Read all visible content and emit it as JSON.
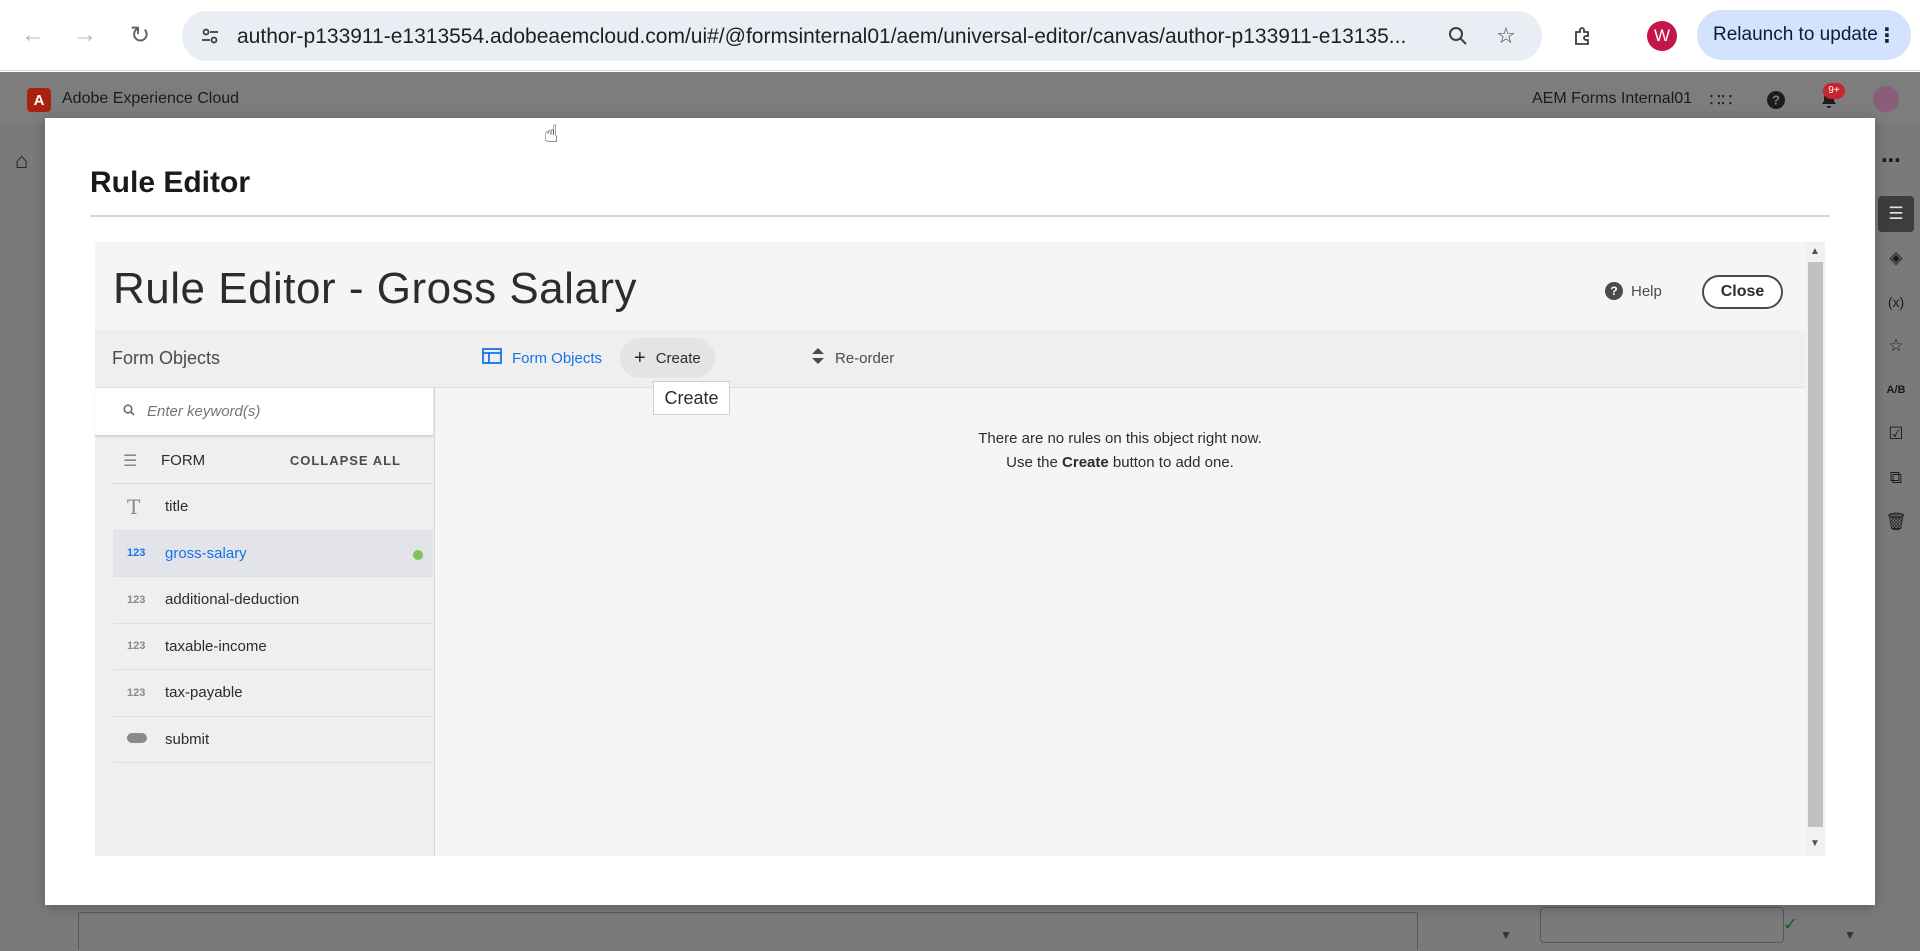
{
  "browser": {
    "url": "author-p133911-e1313554.adobeaemcloud.com/ui#/@formsinternal01/aem/universal-editor/canvas/author-p133911-e13135...",
    "profile_initial": "W",
    "relaunch_label": "Relaunch to update"
  },
  "shell": {
    "title": "Adobe Experience Cloud",
    "org_name": "AEM Forms Internal01",
    "notification_count": "9+"
  },
  "dialog": {
    "title": "Rule Editor"
  },
  "editor": {
    "title": "Rule Editor - Gross Salary",
    "help_label": "Help",
    "close_label": "Close",
    "form_objects_heading": "Form Objects",
    "toolbar": {
      "form_objects_label": "Form Objects",
      "create_label": "Create",
      "reorder_label": "Re-order",
      "create_tooltip": "Create"
    },
    "search": {
      "placeholder": "Enter keyword(s)"
    },
    "tree": {
      "root_label": "FORM",
      "collapse_all_label": "COLLAPSE ALL",
      "items": [
        {
          "label": "title",
          "icon": "text-field-icon",
          "type_glyph": "T"
        },
        {
          "label": "gross-salary",
          "icon": "number-field-icon",
          "type_glyph": "123",
          "selected": true,
          "has_rule": true
        },
        {
          "label": "additional-deduction",
          "icon": "number-field-icon",
          "type_glyph": "123"
        },
        {
          "label": "taxable-income",
          "icon": "number-field-icon",
          "type_glyph": "123"
        },
        {
          "label": "tax-payable",
          "icon": "number-field-icon",
          "type_glyph": "123"
        },
        {
          "label": "submit",
          "icon": "button-icon",
          "type_glyph": ""
        }
      ]
    },
    "empty_message": {
      "line1": "There are no rules on this object right now.",
      "line2_prefix": "Use the ",
      "line2_bold": "Create",
      "line2_suffix": " button to add one."
    }
  },
  "colors": {
    "accent": "#1473e6",
    "rule_status_dot": "#7fc35c",
    "profile_bg": "#c5164c",
    "relaunch_bg": "#d3e3fd"
  }
}
